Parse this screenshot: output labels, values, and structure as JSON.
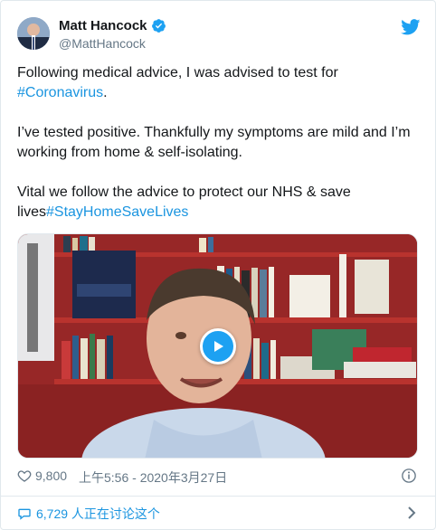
{
  "author": {
    "display_name": "Matt Hancock",
    "handle": "@MattHancock",
    "verified": true
  },
  "tweet": {
    "p1_text": "Following medical advice, I was advised to test for ",
    "p1_hashtag": "#Coronavirus",
    "p1_tail": ".",
    "p2_text": "I’ve tested positive. Thankfully my symptoms are mild and I’m working from home & self-isolating.",
    "p3_text": "Vital we follow the advice to protect our NHS & save lives",
    "p3_hashtag": "#StayHomeSaveLives"
  },
  "media": {
    "type": "video",
    "play_icon": "play-icon"
  },
  "meta": {
    "likes": "9,800",
    "timestamp": "上午5:56 - 2020年3月27日",
    "info_icon": "info-icon"
  },
  "footer": {
    "conversation": "6,729 人正在讨论这个"
  },
  "colors": {
    "accent": "#1b95e0",
    "twitter_blue": "#1da1f2",
    "muted": "#657786",
    "border": "#e1e8ed"
  }
}
